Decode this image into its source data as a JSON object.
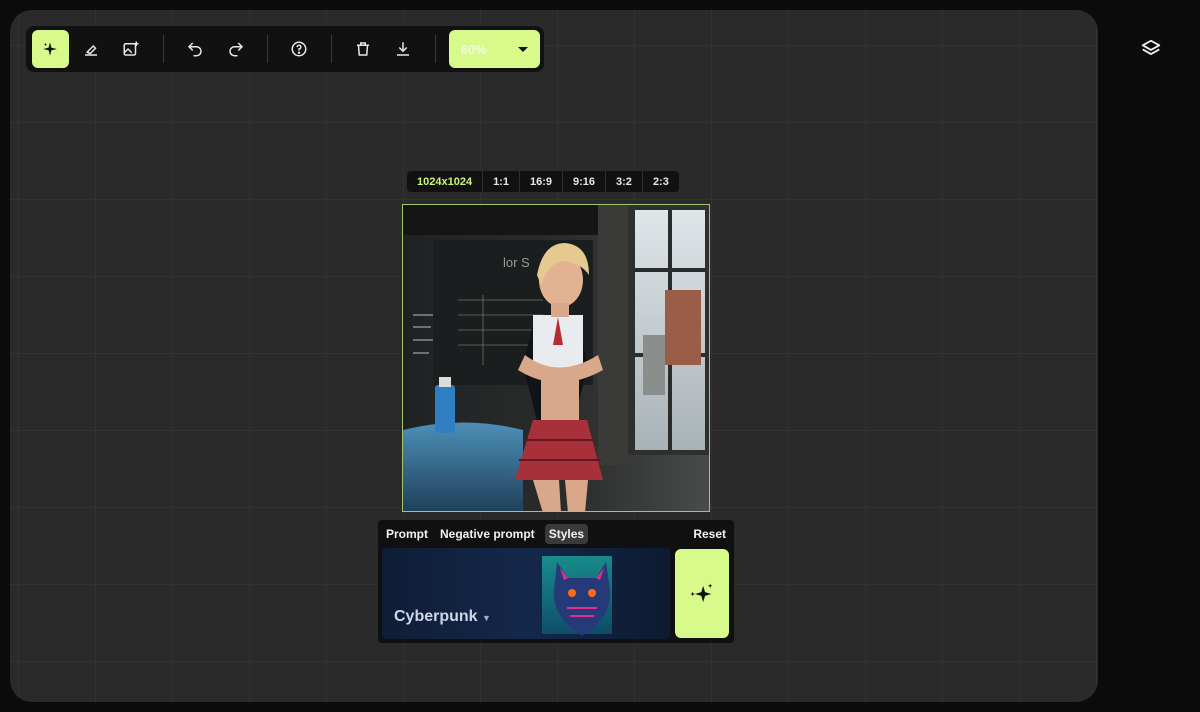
{
  "toolbar": {
    "zoom": "60%",
    "tools": [
      {
        "icon": "sparkle-icon",
        "active": true
      },
      {
        "icon": "eraser-icon"
      },
      {
        "icon": "image-add-icon"
      },
      {
        "icon": "undo-icon"
      },
      {
        "icon": "redo-icon"
      },
      {
        "icon": "help-icon"
      },
      {
        "icon": "trash-icon"
      },
      {
        "icon": "download-icon"
      }
    ]
  },
  "ratios": [
    "1024x1024",
    "1:1",
    "16:9",
    "9:16",
    "3:2",
    "2:3"
  ],
  "prompt_panel": {
    "tabs": [
      "Prompt",
      "Negative prompt",
      "Styles"
    ],
    "active_tab": "Styles",
    "reset_label": "Reset",
    "style_name": "Cyberpunk"
  },
  "colors": {
    "accent": "#d8fa8a",
    "canvas": "#2a2a2a",
    "panel": "#111111"
  }
}
